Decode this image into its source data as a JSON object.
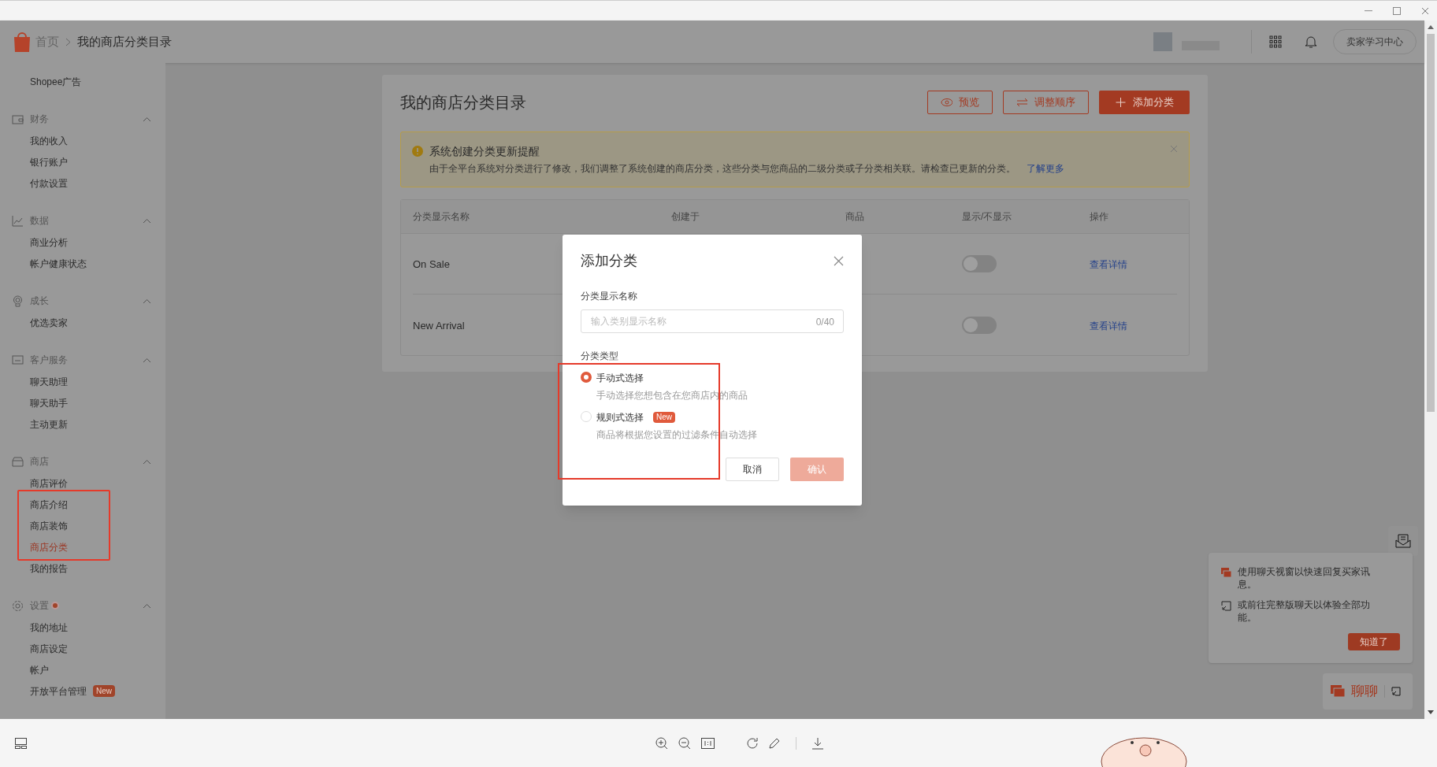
{
  "header": {
    "breadcrumb": [
      {
        "label": "首页"
      },
      {
        "label": "我的商店分类目录"
      }
    ],
    "learning_button": "卖家学习中心"
  },
  "sidebar": {
    "top_items": [
      {
        "label": "Shopee广告",
        "selected": false
      }
    ],
    "sections": [
      {
        "title": "财务",
        "expanded": true,
        "dot": false,
        "items": [
          {
            "label": "我的收入",
            "selected": false
          },
          {
            "label": "银行账户",
            "selected": false
          },
          {
            "label": "付款设置",
            "selected": false
          }
        ]
      },
      {
        "title": "数据",
        "expanded": true,
        "dot": false,
        "items": [
          {
            "label": "商业分析",
            "selected": false
          },
          {
            "label": "帐户健康状态",
            "selected": false
          }
        ]
      },
      {
        "title": "成长",
        "expanded": true,
        "dot": false,
        "items": [
          {
            "label": "优选卖家",
            "selected": false
          }
        ]
      },
      {
        "title": "客户服务",
        "expanded": true,
        "dot": false,
        "items": [
          {
            "label": "聊天助理",
            "selected": false
          },
          {
            "label": "聊天助手",
            "selected": false
          },
          {
            "label": "主动更新",
            "selected": false
          }
        ]
      },
      {
        "title": "商店",
        "expanded": true,
        "dot": false,
        "items": [
          {
            "label": "商店评价",
            "selected": false
          },
          {
            "label": "商店介绍",
            "selected": false
          },
          {
            "label": "商店装饰",
            "selected": false
          },
          {
            "label": "商店分类",
            "selected": true
          },
          {
            "label": "我的报告",
            "selected": false
          }
        ]
      },
      {
        "title": "设置",
        "expanded": true,
        "dot": true,
        "items": [
          {
            "label": "我的地址",
            "selected": false
          },
          {
            "label": "商店设定",
            "selected": false
          },
          {
            "label": "帐户",
            "selected": false
          },
          {
            "label": "开放平台管理",
            "selected": false,
            "badge": "New"
          }
        ]
      }
    ]
  },
  "page": {
    "title": "我的商店分类目录",
    "buttons": [
      {
        "label": "预览",
        "kind": "outline"
      },
      {
        "label": "调整顺序",
        "kind": "outline"
      },
      {
        "label": "添加分类",
        "kind": "primary"
      }
    ],
    "notice": {
      "title": "系统创建分类更新提醒",
      "text": "由于全平台系统对分类进行了修改，我们调整了系统创建的商店分类，这些分类与您商品的二级分类或子分类相关联。请检查已更新的分类。",
      "link": "了解更多"
    },
    "table": {
      "columns": [
        "分类显示名称",
        "创建于",
        "商品",
        "显示/不显示",
        "操作"
      ],
      "rows": [
        {
          "name": "On Sale",
          "on": false,
          "action": "查看详情"
        },
        {
          "name": "New Arrival",
          "on": false,
          "action": "查看详情"
        }
      ]
    }
  },
  "modal": {
    "title": "添加分类",
    "name_label": "分类显示名称",
    "placeholder": "输入类别显示名称",
    "counter": "0/40",
    "type_label": "分类类型",
    "options": [
      {
        "label": "手动式选择",
        "description": "手动选择您想包含在您商店内的商品",
        "selected": true
      },
      {
        "label": "规则式选择",
        "description": "商品将根据您设置的过滤条件自动选择",
        "selected": false,
        "badge": "New"
      }
    ],
    "cancel": "取消",
    "confirm": {
      "label": "确认",
      "disabled": true
    }
  },
  "chat": {
    "tips": [
      "使用聊天视窗以快速回复买家讯息。",
      "或前往完整版聊天以体验全部功能。"
    ],
    "ok_button": "知道了",
    "chat_button": "聊聊"
  }
}
